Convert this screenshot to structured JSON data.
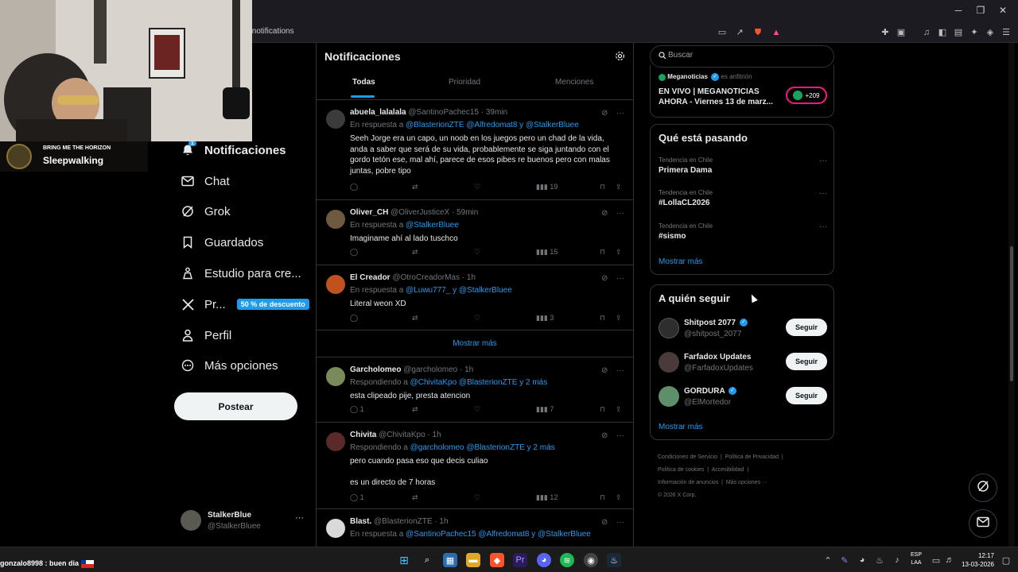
{
  "browser": {
    "url": "/notifications",
    "window_controls": [
      "minimize",
      "restore",
      "close"
    ]
  },
  "overlay": {
    "now_playing_artist": "BRING ME THE HORIZON",
    "now_playing_track": "Sleepwalking",
    "chat_message": "gonzalo8998 : buen dia"
  },
  "nav": {
    "notifications_badge": "1",
    "items": [
      {
        "label": "Notificaciones",
        "icon": "bell-icon"
      },
      {
        "label": "Chat",
        "icon": "mail-icon"
      },
      {
        "label": "Grok",
        "icon": "grok-icon"
      },
      {
        "label": "Guardados",
        "icon": "bookmark-icon"
      },
      {
        "label": "Estudio para cre...",
        "icon": "studio-icon"
      },
      {
        "label": "Pr...",
        "icon": "x-logo-icon"
      },
      {
        "label": "Perfil",
        "icon": "person-icon"
      },
      {
        "label": "Más opciones",
        "icon": "more-circle-icon"
      }
    ],
    "premium_badge": "50 % de descuento",
    "post_button": "Postear",
    "account": {
      "name": "StalkerBlue",
      "handle": "@StalkerBluee"
    }
  },
  "center": {
    "title": "Notificaciones",
    "tabs": [
      "Todas",
      "Prioridad",
      "Menciones"
    ],
    "show_more": "Mostrar más",
    "posts": [
      {
        "name": "abuela_lalalala",
        "handle": "@SantinoPachec15",
        "time": "· 39min",
        "reply_prefix": "En respuesta a",
        "reply_to": "@BlasterionZTE @Alfredomat8 y @StalkerBluee",
        "text": "Seeh Jorge era un capo, un noob en los juegos pero un chad de la vida, anda a saber que será de su vida, probablemente se siga juntando con el gordo tetón ese, mal ahí, parece de esos pibes re buenos pero con malas juntas, pobre tipo",
        "replies": "",
        "views": "19"
      },
      {
        "name": "Oliver_CH",
        "handle": "@OliverJusticeX",
        "time": "· 59min",
        "reply_prefix": "En respuesta a",
        "reply_to": "@StalkerBluee",
        "text": "Imaginame ahí al lado tuschco",
        "replies": "",
        "views": "15"
      },
      {
        "name": "El Creador",
        "handle": "@OtroCreadorMas",
        "time": "· 1h",
        "reply_prefix": "En respuesta a",
        "reply_to": "@Luwu777_ y @StalkerBluee",
        "text": "Literal weon XD",
        "replies": "",
        "views": "3"
      },
      {
        "name": "Garcholomeo",
        "handle": "@garcholomeo",
        "time": "· 1h",
        "reply_prefix": "Respondiendo a",
        "reply_to": "@ChivitaKpo @BlasterionZTE y 2 más",
        "text": "esta clipeado pije, presta atencion",
        "replies": "1",
        "views": "7"
      },
      {
        "name": "Chivita",
        "handle": "@ChivitaKpo",
        "time": "· 1h",
        "reply_prefix": "Respondiendo a",
        "reply_to": "@garcholomeo @BlasterionZTE y 2 más",
        "text": "pero cuando pasa eso que decis culiao\n\nes un directo de 7 horas",
        "replies": "1",
        "views": "12"
      },
      {
        "name": "Blast.",
        "handle": "@BlasterionZTE",
        "time": "· 1h",
        "reply_prefix": "En respuesta a",
        "reply_to": "@SantinoPachec15 @Alfredomat8 y @StalkerBluee",
        "text": "",
        "replies": "",
        "views": ""
      }
    ]
  },
  "right": {
    "search_placeholder": "Buscar",
    "live": {
      "host": "Meganoticias",
      "host_suffix": "es anfitrión",
      "title": "EN VIVO | MEGANOTICIAS AHORA - Viernes 13 de marz...",
      "listeners": "+209"
    },
    "trends_title": "Qué está pasando",
    "trends": [
      {
        "context": "Tendencia en Chile",
        "name": "Primera Dama"
      },
      {
        "context": "Tendencia en Chile",
        "name": "#LollaCL2026"
      },
      {
        "context": "Tendencia en Chile",
        "name": "#sismo"
      }
    ],
    "trends_show_more": "Mostrar más",
    "follow_title": "A quién seguir",
    "follow": [
      {
        "name": "Shitpost 2077",
        "handle": "@shitpost_2077",
        "verified": true,
        "button": "Seguir"
      },
      {
        "name": "Farfadox Updates",
        "handle": "@FarfadoxUpdates",
        "verified": false,
        "button": "Seguir"
      },
      {
        "name": "GORDURA",
        "handle": "@ElMortedor",
        "verified": true,
        "button": "Seguir"
      }
    ],
    "follow_show_more": "Mostrar más",
    "footer": [
      "Condiciones de Servicio",
      "Política de Privacidad",
      "Política de cookies",
      "Accesibilidad",
      "Información de anuncios",
      "Más opciones ···",
      "© 2026 X Corp."
    ]
  },
  "taskbar": {
    "lang_top": "ESP",
    "lang_bottom": "LAA",
    "time": "12:17",
    "date": "13-03-2026"
  },
  "colors": {
    "accent": "#1d9bf0",
    "background": "#000000",
    "border": "#2f3336",
    "muted": "#71767b"
  }
}
